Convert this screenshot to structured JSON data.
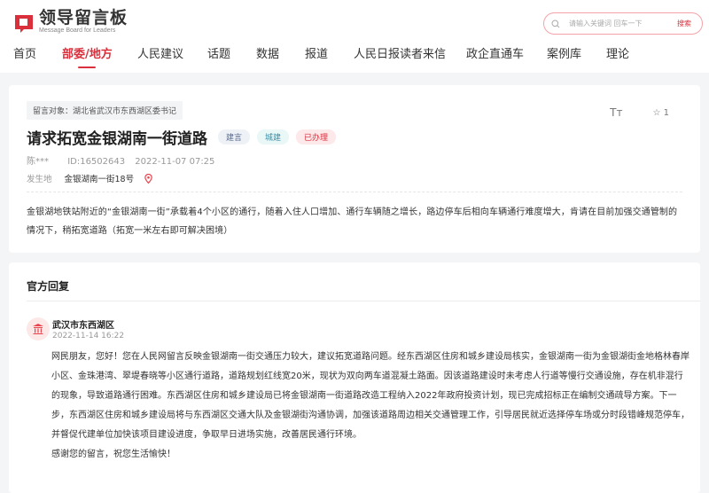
{
  "header": {
    "logo_name": "领导留言板",
    "logo_sub": "Message Board for Leaders",
    "search_placeholder": "请输入关键词 回车一下",
    "search_button": "搜索"
  },
  "nav": [
    "首页",
    "部委/地方",
    "人民建议",
    "话题",
    "数据",
    "报道",
    "人民日报读者来信",
    "政企直通车",
    "案例库",
    "理论"
  ],
  "message": {
    "target": "留言对象：湖北省武汉市东西湖区委书记",
    "title": "请求拓宽金银湖南一街道路",
    "tags": [
      {
        "label": "建言",
        "color": "#5b6b8c",
        "bg": "#eef1f6"
      },
      {
        "label": "城建",
        "color": "#3d8ea8",
        "bg": "#e9f7f6"
      },
      {
        "label": "已办理",
        "color": "#d9303c",
        "bg": "#fde8ea"
      }
    ],
    "author": "陈***",
    "id": "ID:16502643",
    "time": "2022-11-07 07:25",
    "place_label": "发生地",
    "place": "金银湖南一街18号",
    "font_tool": "Tт",
    "favorites": "1",
    "body": "金银湖地铁站附近的“金银湖南一街”承载着4个小区的通行，随着入住人口增加、通行车辆随之增长，路边停车后相向车辆通行难度增大，肯请在目前加强交通管制的情况下，稍拓宽道路（拓宽一米左右即可解决困境）"
  },
  "reply": {
    "heading": "官方回复",
    "org": "武汉市东西湖区",
    "time": "2022-11-14 16:22",
    "body": "网民朋友，您好！您在人民网留言反映金银湖南一街交通压力较大，建议拓宽道路问题。经东西湖区住房和城乡建设局核实，金银湖南一街为金银湖街金地格林春岸小区、金珠港湾、翠堤春晓等小区通行道路，道路规划红线宽20米，现状为双向两车道混凝土路面。因该道路建设时未考虑人行道等慢行交通设施，存在机非混行的现象，导致道路通行困难。东西湖区住房和城乡建设局已将金银湖南一街道路改造工程纳入2022年政府投资计划，现已完成招标正在编制交通疏导方案。下一步，东西湖区住房和城乡建设局将与东西湖区交通大队及金银湖街沟通协调，加强该道路周边相关交通管理工作，引导居民就近选择停车场或分时段错峰规范停车，并督促代建单位加快该项目建设进度，争取早日进场实施，改善居民通行环境。",
    "thanks": "感谢您的留言，祝您生活愉快！"
  }
}
